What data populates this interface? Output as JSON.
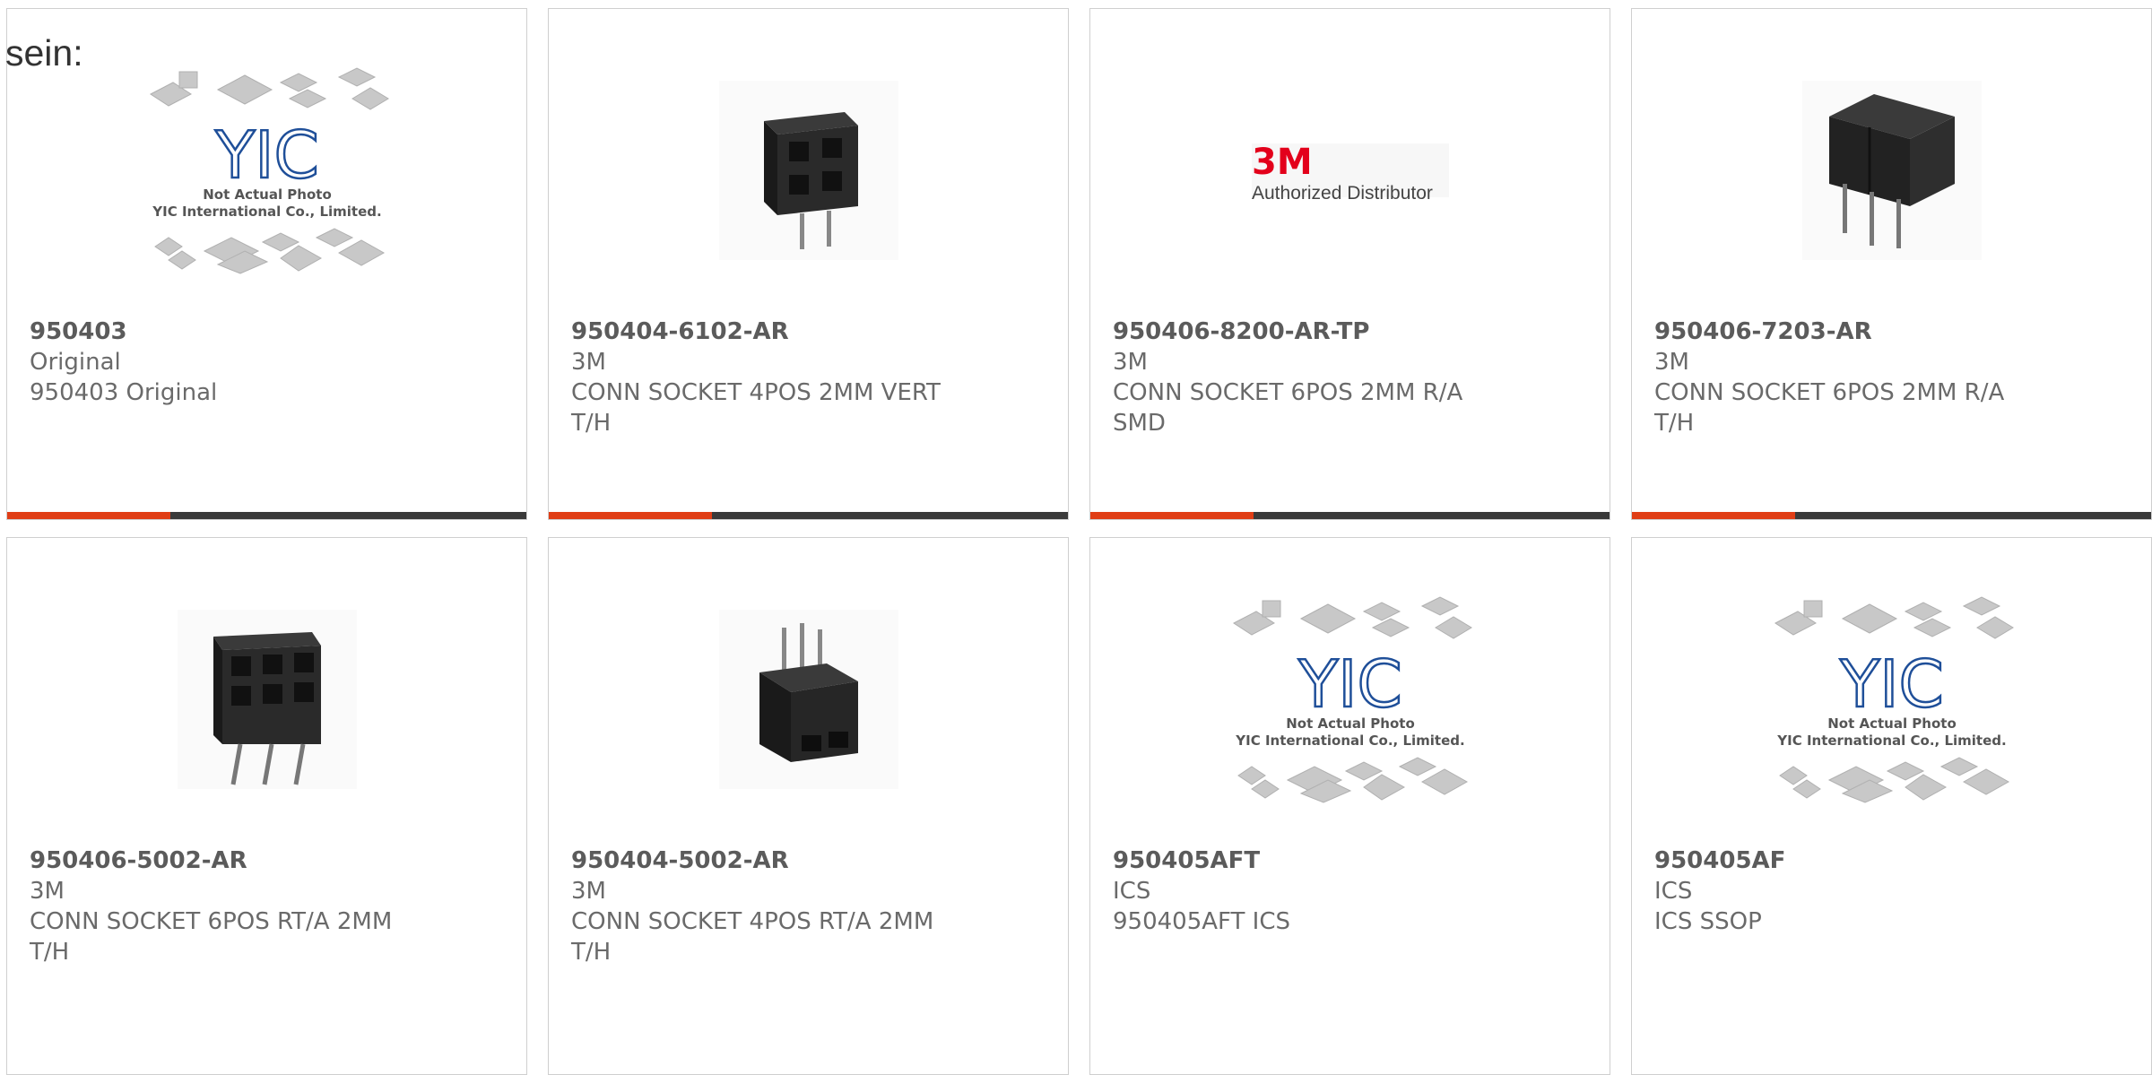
{
  "heading": "sein:",
  "colors": {
    "accent": "#e03e16",
    "bar": "#3a3a3a",
    "border": "#cfcfcf"
  },
  "placeholder": {
    "caption1": "Not Actual Photo",
    "caption2": "YIC International Co., Limited.",
    "logo": "YIC"
  },
  "brand_logo": {
    "mark": "3M",
    "text": "Authorized Distributor"
  },
  "products": [
    {
      "part_number": "950403",
      "manufacturer": "Original",
      "desc_line1": "950403 Original",
      "desc_line2": "",
      "image": "placeholder"
    },
    {
      "part_number": "950404-6102-AR",
      "manufacturer": "3M",
      "desc_line1": "CONN SOCKET 4POS 2MM VERT",
      "desc_line2": "T/H",
      "image": "socket-4pos-vert-icon"
    },
    {
      "part_number": "950406-8200-AR-TP",
      "manufacturer": "3M",
      "desc_line1": "CONN SOCKET 6POS 2MM R/A",
      "desc_line2": "SMD",
      "image": "3m-logo"
    },
    {
      "part_number": "950406-7203-AR",
      "manufacturer": "3M",
      "desc_line1": "CONN SOCKET 6POS 2MM R/A",
      "desc_line2": "T/H",
      "image": "socket-6pos-ra-icon"
    },
    {
      "part_number": "950406-5002-AR",
      "manufacturer": "3M",
      "desc_line1": "CONN SOCKET 6POS RT/A 2MM",
      "desc_line2": "T/H",
      "image": "socket-6pos-rta-icon"
    },
    {
      "part_number": "950404-5002-AR",
      "manufacturer": "3M",
      "desc_line1": "CONN SOCKET 4POS RT/A 2MM",
      "desc_line2": "T/H",
      "image": "socket-4pos-rta-icon"
    },
    {
      "part_number": "950405AFT",
      "manufacturer": "ICS",
      "desc_line1": "950405AFT ICS",
      "desc_line2": "",
      "image": "placeholder"
    },
    {
      "part_number": "950405AF",
      "manufacturer": "ICS",
      "desc_line1": "ICS SSOP",
      "desc_line2": "",
      "image": "placeholder"
    }
  ]
}
